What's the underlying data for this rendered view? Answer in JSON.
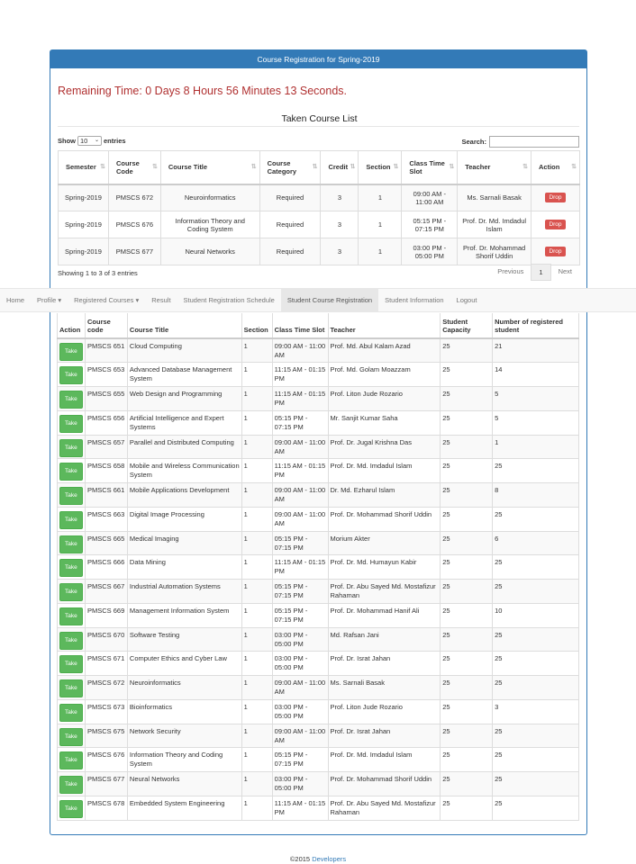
{
  "panel": {
    "title": "Course Registration for Spring-2019"
  },
  "remaining_time": "Remaining Time: 0 Days 8 Hours 56 Minutes 13 Seconds.",
  "taken": {
    "title": "Taken Course List",
    "show_label": "Show",
    "entries_value": "10",
    "entries_label": "entries",
    "search_label": "Search:",
    "columns": [
      "Semester",
      "Course Code",
      "Course Title",
      "Course Category",
      "Credit",
      "Section",
      "Class Time Slot",
      "Teacher",
      "Action"
    ],
    "rows": [
      [
        "Spring-2019",
        "PMSCS 672",
        "Neuroinformatics",
        "Required",
        "3",
        "1",
        "09:00 AM - 11:00 AM",
        "Ms. Sarnali Basak",
        "Drop"
      ],
      [
        "Spring-2019",
        "PMSCS 676",
        "Information Theory and Coding System",
        "Required",
        "3",
        "1",
        "05:15 PM - 07:15 PM",
        "Prof. Dr. Md. Imdadul Islam",
        "Drop"
      ],
      [
        "Spring-2019",
        "PMSCS 677",
        "Neural Networks",
        "Required",
        "3",
        "1",
        "03:00 PM - 05:00 PM",
        "Prof. Dr. Mohammad Shorif Uddin",
        "Drop"
      ]
    ],
    "showing": "Showing 1 to 3 of 3 entries",
    "pager": {
      "prev": "Previous",
      "page": "1",
      "next": "Next"
    }
  },
  "nav": [
    "Home",
    "Profile ▾",
    "Registered Courses ▾",
    "Result",
    "Student Registration Schedule",
    "Student Course Registration",
    "Student Information",
    "Logout"
  ],
  "nav_active_index": 5,
  "offered": {
    "columns": [
      "Action",
      "Course code",
      "Course Title",
      "Section",
      "Class Time Slot",
      "Teacher",
      "Student Capacity",
      "Number of registered student"
    ],
    "rows": [
      [
        "Take",
        "PMSCS 651",
        "Cloud Computing",
        "1",
        "09:00 AM - 11:00 AM",
        "Prof. Md. Abul Kalam Azad",
        "25",
        "21"
      ],
      [
        "Take",
        "PMSCS 653",
        "Advanced Database Management System",
        "1",
        "11:15 AM - 01:15 PM",
        "Prof. Md. Golam Moazzam",
        "25",
        "14"
      ],
      [
        "Take",
        "PMSCS 655",
        "Web Design and Programming",
        "1",
        "11:15 AM - 01:15 PM",
        "Prof. Liton Jude Rozario",
        "25",
        "5"
      ],
      [
        "Take",
        "PMSCS 656",
        "Artificial Intelligence and Expert Systems",
        "1",
        "05:15 PM - 07:15 PM",
        "Mr. Sanjit Kumar Saha",
        "25",
        "5"
      ],
      [
        "Take",
        "PMSCS 657",
        "Parallel and Distributed Computing",
        "1",
        "09:00 AM - 11:00 AM",
        "Prof. Dr. Jugal Krishna Das",
        "25",
        "1"
      ],
      [
        "Take",
        "PMSCS 658",
        "Mobile and Wireless Communication System",
        "1",
        "11:15 AM - 01:15 PM",
        "Prof. Dr. Md. Imdadul Islam",
        "25",
        "25"
      ],
      [
        "Take",
        "PMSCS 661",
        "Mobile Applications Development",
        "1",
        "09:00 AM - 11:00 AM",
        "Dr. Md. Ezharul Islam",
        "25",
        "8"
      ],
      [
        "Take",
        "PMSCS 663",
        "Digital Image Processing",
        "1",
        "09:00 AM - 11:00 AM",
        "Prof. Dr. Mohammad Shorif Uddin",
        "25",
        "25"
      ],
      [
        "Take",
        "PMSCS 665",
        "Medical Imaging",
        "1",
        "05:15 PM - 07:15 PM",
        "Morium Akter",
        "25",
        "6"
      ],
      [
        "Take",
        "PMSCS 666",
        "Data Mining",
        "1",
        "11:15 AM - 01:15 PM",
        "Prof. Dr. Md. Humayun Kabir",
        "25",
        "25"
      ],
      [
        "Take",
        "PMSCS 667",
        "Industrial Automation Systems",
        "1",
        "05:15 PM - 07:15 PM",
        "Prof. Dr. Abu Sayed Md. Mostafizur Rahaman",
        "25",
        "25"
      ],
      [
        "Take",
        "PMSCS 669",
        "Management Information System",
        "1",
        "05:15 PM - 07:15 PM",
        "Prof. Dr. Mohammad Hanif Ali",
        "25",
        "10"
      ],
      [
        "Take",
        "PMSCS 670",
        "Software Testing",
        "1",
        "03:00 PM - 05:00 PM",
        "Md. Rafsan Jani",
        "25",
        "25"
      ],
      [
        "Take",
        "PMSCS 671",
        "Computer Ethics and Cyber Law",
        "1",
        "03:00 PM - 05:00 PM",
        "Prof. Dr. Israt Jahan",
        "25",
        "25"
      ],
      [
        "Take",
        "PMSCS 672",
        "Neuroinformatics",
        "1",
        "09:00 AM - 11:00 AM",
        "Ms. Sarnali Basak",
        "25",
        "25"
      ],
      [
        "Take",
        "PMSCS 673",
        "Bioinformatics",
        "1",
        "03:00 PM - 05:00 PM",
        "Prof. Liton Jude Rozario",
        "25",
        "3"
      ],
      [
        "Take",
        "PMSCS 675",
        "Network Security",
        "1",
        "09:00 AM - 11:00 AM",
        "Prof. Dr. Israt Jahan",
        "25",
        "25"
      ],
      [
        "Take",
        "PMSCS 676",
        "Information Theory and Coding System",
        "1",
        "05:15 PM - 07:15 PM",
        "Prof. Dr. Md. Imdadul Islam",
        "25",
        "25"
      ],
      [
        "Take",
        "PMSCS 677",
        "Neural Networks",
        "1",
        "03:00 PM - 05:00 PM",
        "Prof. Dr. Mohammad Shorif Uddin",
        "25",
        "25"
      ],
      [
        "Take",
        "PMSCS 678",
        "Embedded System Engineering",
        "1",
        "11:15 AM - 01:15 PM",
        "Prof. Dr. Abu Sayed Md. Mostafizur Rahaman",
        "25",
        "25"
      ]
    ]
  },
  "footer": {
    "copyright": "©2015",
    "link": "Developers"
  }
}
